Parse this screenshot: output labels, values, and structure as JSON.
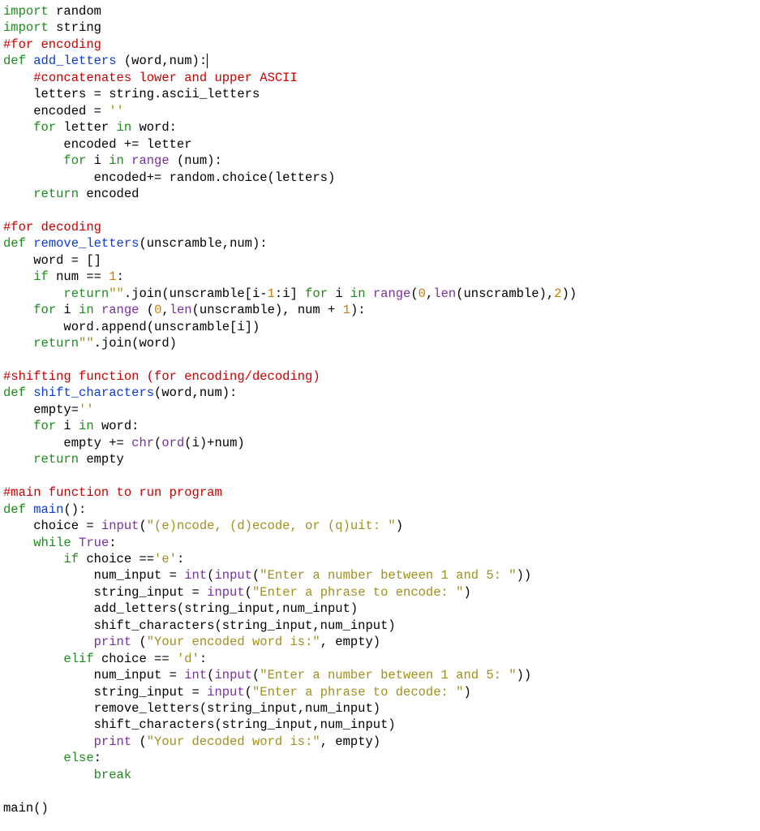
{
  "code": {
    "lines": [
      [
        {
          "t": "import ",
          "c": "kw"
        },
        {
          "t": "random",
          "c": "mod"
        }
      ],
      [
        {
          "t": "import ",
          "c": "kw"
        },
        {
          "t": "string",
          "c": "mod"
        }
      ],
      [
        {
          "t": "#for encoding",
          "c": "cmt"
        }
      ],
      [
        {
          "t": "def ",
          "c": "kw"
        },
        {
          "t": "add_letters",
          "c": "fn"
        },
        {
          "t": " (word,num):",
          "c": "op"
        },
        {
          "t": "",
          "c": "cursor"
        }
      ],
      [
        {
          "t": "    ",
          "c": "op"
        },
        {
          "t": "#concatenates lower and upper ASCII",
          "c": "cmt"
        }
      ],
      [
        {
          "t": "    letters = string.ascii_letters",
          "c": "op"
        }
      ],
      [
        {
          "t": "    encoded = ",
          "c": "op"
        },
        {
          "t": "''",
          "c": "str"
        }
      ],
      [
        {
          "t": "    ",
          "c": "op"
        },
        {
          "t": "for",
          "c": "kw"
        },
        {
          "t": " letter ",
          "c": "op"
        },
        {
          "t": "in",
          "c": "kw"
        },
        {
          "t": " word:",
          "c": "op"
        }
      ],
      [
        {
          "t": "        encoded += letter",
          "c": "op"
        }
      ],
      [
        {
          "t": "        ",
          "c": "op"
        },
        {
          "t": "for",
          "c": "kw"
        },
        {
          "t": " i ",
          "c": "op"
        },
        {
          "t": "in",
          "c": "kw"
        },
        {
          "t": " ",
          "c": "op"
        },
        {
          "t": "range",
          "c": "bi"
        },
        {
          "t": " (num):",
          "c": "op"
        }
      ],
      [
        {
          "t": "            encoded+= random.choice(letters)",
          "c": "op"
        }
      ],
      [
        {
          "t": "    ",
          "c": "op"
        },
        {
          "t": "return",
          "c": "kw"
        },
        {
          "t": " encoded",
          "c": "op"
        }
      ],
      [
        {
          "t": "",
          "c": "op"
        }
      ],
      [
        {
          "t": "#for decoding",
          "c": "cmt"
        }
      ],
      [
        {
          "t": "def ",
          "c": "kw"
        },
        {
          "t": "remove_letters",
          "c": "fn"
        },
        {
          "t": "(unscramble,num):",
          "c": "op"
        }
      ],
      [
        {
          "t": "    word = []",
          "c": "op"
        }
      ],
      [
        {
          "t": "    ",
          "c": "op"
        },
        {
          "t": "if",
          "c": "kw"
        },
        {
          "t": " num == ",
          "c": "op"
        },
        {
          "t": "1",
          "c": "num"
        },
        {
          "t": ":",
          "c": "op"
        }
      ],
      [
        {
          "t": "        ",
          "c": "op"
        },
        {
          "t": "return",
          "c": "kw"
        },
        {
          "t": "\"\"",
          "c": "str"
        },
        {
          "t": ".join(unscramble[i-",
          "c": "op"
        },
        {
          "t": "1",
          "c": "num"
        },
        {
          "t": ":i] ",
          "c": "op"
        },
        {
          "t": "for",
          "c": "kw"
        },
        {
          "t": " i ",
          "c": "op"
        },
        {
          "t": "in",
          "c": "kw"
        },
        {
          "t": " ",
          "c": "op"
        },
        {
          "t": "range",
          "c": "bi"
        },
        {
          "t": "(",
          "c": "op"
        },
        {
          "t": "0",
          "c": "num"
        },
        {
          "t": ",",
          "c": "op"
        },
        {
          "t": "len",
          "c": "bi"
        },
        {
          "t": "(unscramble),",
          "c": "op"
        },
        {
          "t": "2",
          "c": "num"
        },
        {
          "t": "))",
          "c": "op"
        }
      ],
      [
        {
          "t": "    ",
          "c": "op"
        },
        {
          "t": "for",
          "c": "kw"
        },
        {
          "t": " i ",
          "c": "op"
        },
        {
          "t": "in",
          "c": "kw"
        },
        {
          "t": " ",
          "c": "op"
        },
        {
          "t": "range",
          "c": "bi"
        },
        {
          "t": " (",
          "c": "op"
        },
        {
          "t": "0",
          "c": "num"
        },
        {
          "t": ",",
          "c": "op"
        },
        {
          "t": "len",
          "c": "bi"
        },
        {
          "t": "(unscramble), num + ",
          "c": "op"
        },
        {
          "t": "1",
          "c": "num"
        },
        {
          "t": "):",
          "c": "op"
        }
      ],
      [
        {
          "t": "        word.append(unscramble[i])",
          "c": "op"
        }
      ],
      [
        {
          "t": "    ",
          "c": "op"
        },
        {
          "t": "return",
          "c": "kw"
        },
        {
          "t": "\"\"",
          "c": "str"
        },
        {
          "t": ".join(word)",
          "c": "op"
        }
      ],
      [
        {
          "t": "",
          "c": "op"
        }
      ],
      [
        {
          "t": "#shifting function (for encoding/decoding)",
          "c": "cmt"
        }
      ],
      [
        {
          "t": "def ",
          "c": "kw"
        },
        {
          "t": "shift_characters",
          "c": "fn"
        },
        {
          "t": "(word,num):",
          "c": "op"
        }
      ],
      [
        {
          "t": "    empty=",
          "c": "op"
        },
        {
          "t": "''",
          "c": "str"
        }
      ],
      [
        {
          "t": "    ",
          "c": "op"
        },
        {
          "t": "for",
          "c": "kw"
        },
        {
          "t": " i ",
          "c": "op"
        },
        {
          "t": "in",
          "c": "kw"
        },
        {
          "t": " word:",
          "c": "op"
        }
      ],
      [
        {
          "t": "        empty += ",
          "c": "op"
        },
        {
          "t": "chr",
          "c": "bi"
        },
        {
          "t": "(",
          "c": "op"
        },
        {
          "t": "ord",
          "c": "bi"
        },
        {
          "t": "(i)+num)",
          "c": "op"
        }
      ],
      [
        {
          "t": "    ",
          "c": "op"
        },
        {
          "t": "return",
          "c": "kw"
        },
        {
          "t": " empty",
          "c": "op"
        }
      ],
      [
        {
          "t": "",
          "c": "op"
        }
      ],
      [
        {
          "t": "#main function to run program",
          "c": "cmt"
        }
      ],
      [
        {
          "t": "def ",
          "c": "kw"
        },
        {
          "t": "main",
          "c": "fn"
        },
        {
          "t": "():",
          "c": "op"
        }
      ],
      [
        {
          "t": "    choice = ",
          "c": "op"
        },
        {
          "t": "input",
          "c": "bi"
        },
        {
          "t": "(",
          "c": "op"
        },
        {
          "t": "\"(e)ncode, (d)ecode, or (q)uit: \"",
          "c": "str"
        },
        {
          "t": ")",
          "c": "op"
        }
      ],
      [
        {
          "t": "    ",
          "c": "op"
        },
        {
          "t": "while",
          "c": "kw"
        },
        {
          "t": " ",
          "c": "op"
        },
        {
          "t": "True",
          "c": "bi"
        },
        {
          "t": ":",
          "c": "op"
        }
      ],
      [
        {
          "t": "        ",
          "c": "op"
        },
        {
          "t": "if",
          "c": "kw"
        },
        {
          "t": " choice ==",
          "c": "op"
        },
        {
          "t": "'e'",
          "c": "str"
        },
        {
          "t": ":",
          "c": "op"
        }
      ],
      [
        {
          "t": "            num_input = ",
          "c": "op"
        },
        {
          "t": "int",
          "c": "bi"
        },
        {
          "t": "(",
          "c": "op"
        },
        {
          "t": "input",
          "c": "bi"
        },
        {
          "t": "(",
          "c": "op"
        },
        {
          "t": "\"Enter a number between 1 and 5: \"",
          "c": "str"
        },
        {
          "t": "))",
          "c": "op"
        }
      ],
      [
        {
          "t": "            string_input = ",
          "c": "op"
        },
        {
          "t": "input",
          "c": "bi"
        },
        {
          "t": "(",
          "c": "op"
        },
        {
          "t": "\"Enter a phrase to encode: \"",
          "c": "str"
        },
        {
          "t": ")",
          "c": "op"
        }
      ],
      [
        {
          "t": "            add_letters(string_input,num_input)",
          "c": "op"
        }
      ],
      [
        {
          "t": "            shift_characters(string_input,num_input)",
          "c": "op"
        }
      ],
      [
        {
          "t": "            ",
          "c": "op"
        },
        {
          "t": "print",
          "c": "bi"
        },
        {
          "t": " (",
          "c": "op"
        },
        {
          "t": "\"Your encoded word is:\"",
          "c": "str"
        },
        {
          "t": ", empty)",
          "c": "op"
        }
      ],
      [
        {
          "t": "        ",
          "c": "op"
        },
        {
          "t": "elif",
          "c": "kw"
        },
        {
          "t": " choice == ",
          "c": "op"
        },
        {
          "t": "'d'",
          "c": "str"
        },
        {
          "t": ":",
          "c": "op"
        }
      ],
      [
        {
          "t": "            num_input = ",
          "c": "op"
        },
        {
          "t": "int",
          "c": "bi"
        },
        {
          "t": "(",
          "c": "op"
        },
        {
          "t": "input",
          "c": "bi"
        },
        {
          "t": "(",
          "c": "op"
        },
        {
          "t": "\"Enter a number between 1 and 5: \"",
          "c": "str"
        },
        {
          "t": "))",
          "c": "op"
        }
      ],
      [
        {
          "t": "            string_input = ",
          "c": "op"
        },
        {
          "t": "input",
          "c": "bi"
        },
        {
          "t": "(",
          "c": "op"
        },
        {
          "t": "\"Enter a phrase to decode: \"",
          "c": "str"
        },
        {
          "t": ")",
          "c": "op"
        }
      ],
      [
        {
          "t": "            remove_letters(string_input,num_input)",
          "c": "op"
        }
      ],
      [
        {
          "t": "            shift_characters(string_input,num_input)",
          "c": "op"
        }
      ],
      [
        {
          "t": "            ",
          "c": "op"
        },
        {
          "t": "print",
          "c": "bi"
        },
        {
          "t": " (",
          "c": "op"
        },
        {
          "t": "\"Your decoded word is:\"",
          "c": "str"
        },
        {
          "t": ", empty)",
          "c": "op"
        }
      ],
      [
        {
          "t": "        ",
          "c": "op"
        },
        {
          "t": "else",
          "c": "kw"
        },
        {
          "t": ":",
          "c": "op"
        }
      ],
      [
        {
          "t": "            ",
          "c": "op"
        },
        {
          "t": "break",
          "c": "kw"
        }
      ],
      [
        {
          "t": "",
          "c": "op"
        }
      ],
      [
        {
          "t": "main()",
          "c": "op"
        }
      ]
    ]
  }
}
